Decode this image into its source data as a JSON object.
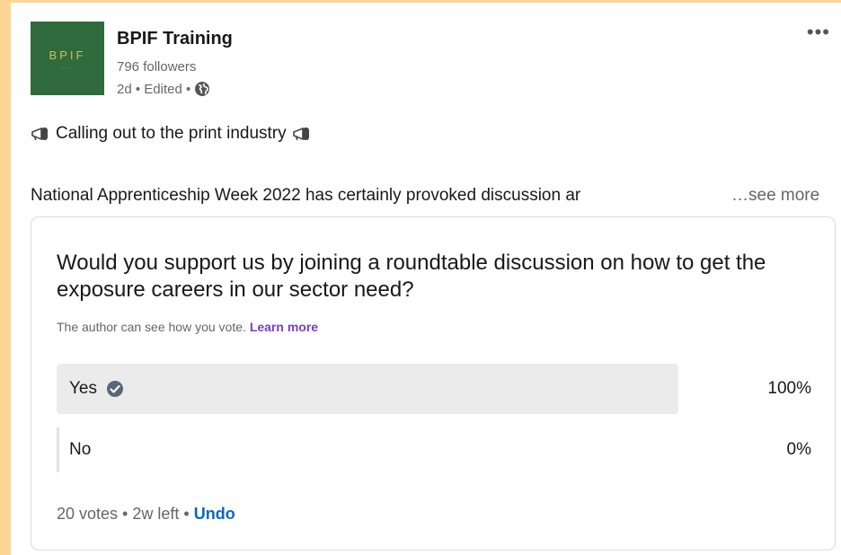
{
  "author": {
    "logo_text": "BPIF",
    "name": "BPIF Training",
    "followers": "796 followers",
    "meta": "2d • Edited •"
  },
  "post": {
    "line1": "Calling out to the print industry",
    "line2": "National Apprenticeship Week 2022 has certainly provoked discussion ar",
    "see_more": "…see more"
  },
  "poll": {
    "question": "Would you support us by joining a roundtable discussion on how to get the exposure careers in our sector need?",
    "notice": "The author can see how you vote.",
    "learn_more": "Learn more",
    "options": [
      {
        "label": "Yes",
        "percent_text": "100%",
        "percent": 100,
        "selected": true
      },
      {
        "label": "No",
        "percent_text": "0%",
        "percent": 0,
        "selected": false
      }
    ],
    "footer": "20 votes • 2w left •",
    "undo": "Undo"
  },
  "colors": {
    "background": "#fdd696",
    "logo_bg": "#2f6b3d",
    "link_purple": "#7a3cc3",
    "link_blue": "#0a66c2",
    "bar_fill": "#ebebeb"
  },
  "icons": [
    "overflow-menu-icon",
    "globe-icon",
    "megaphone-icon",
    "check-circle-icon"
  ]
}
